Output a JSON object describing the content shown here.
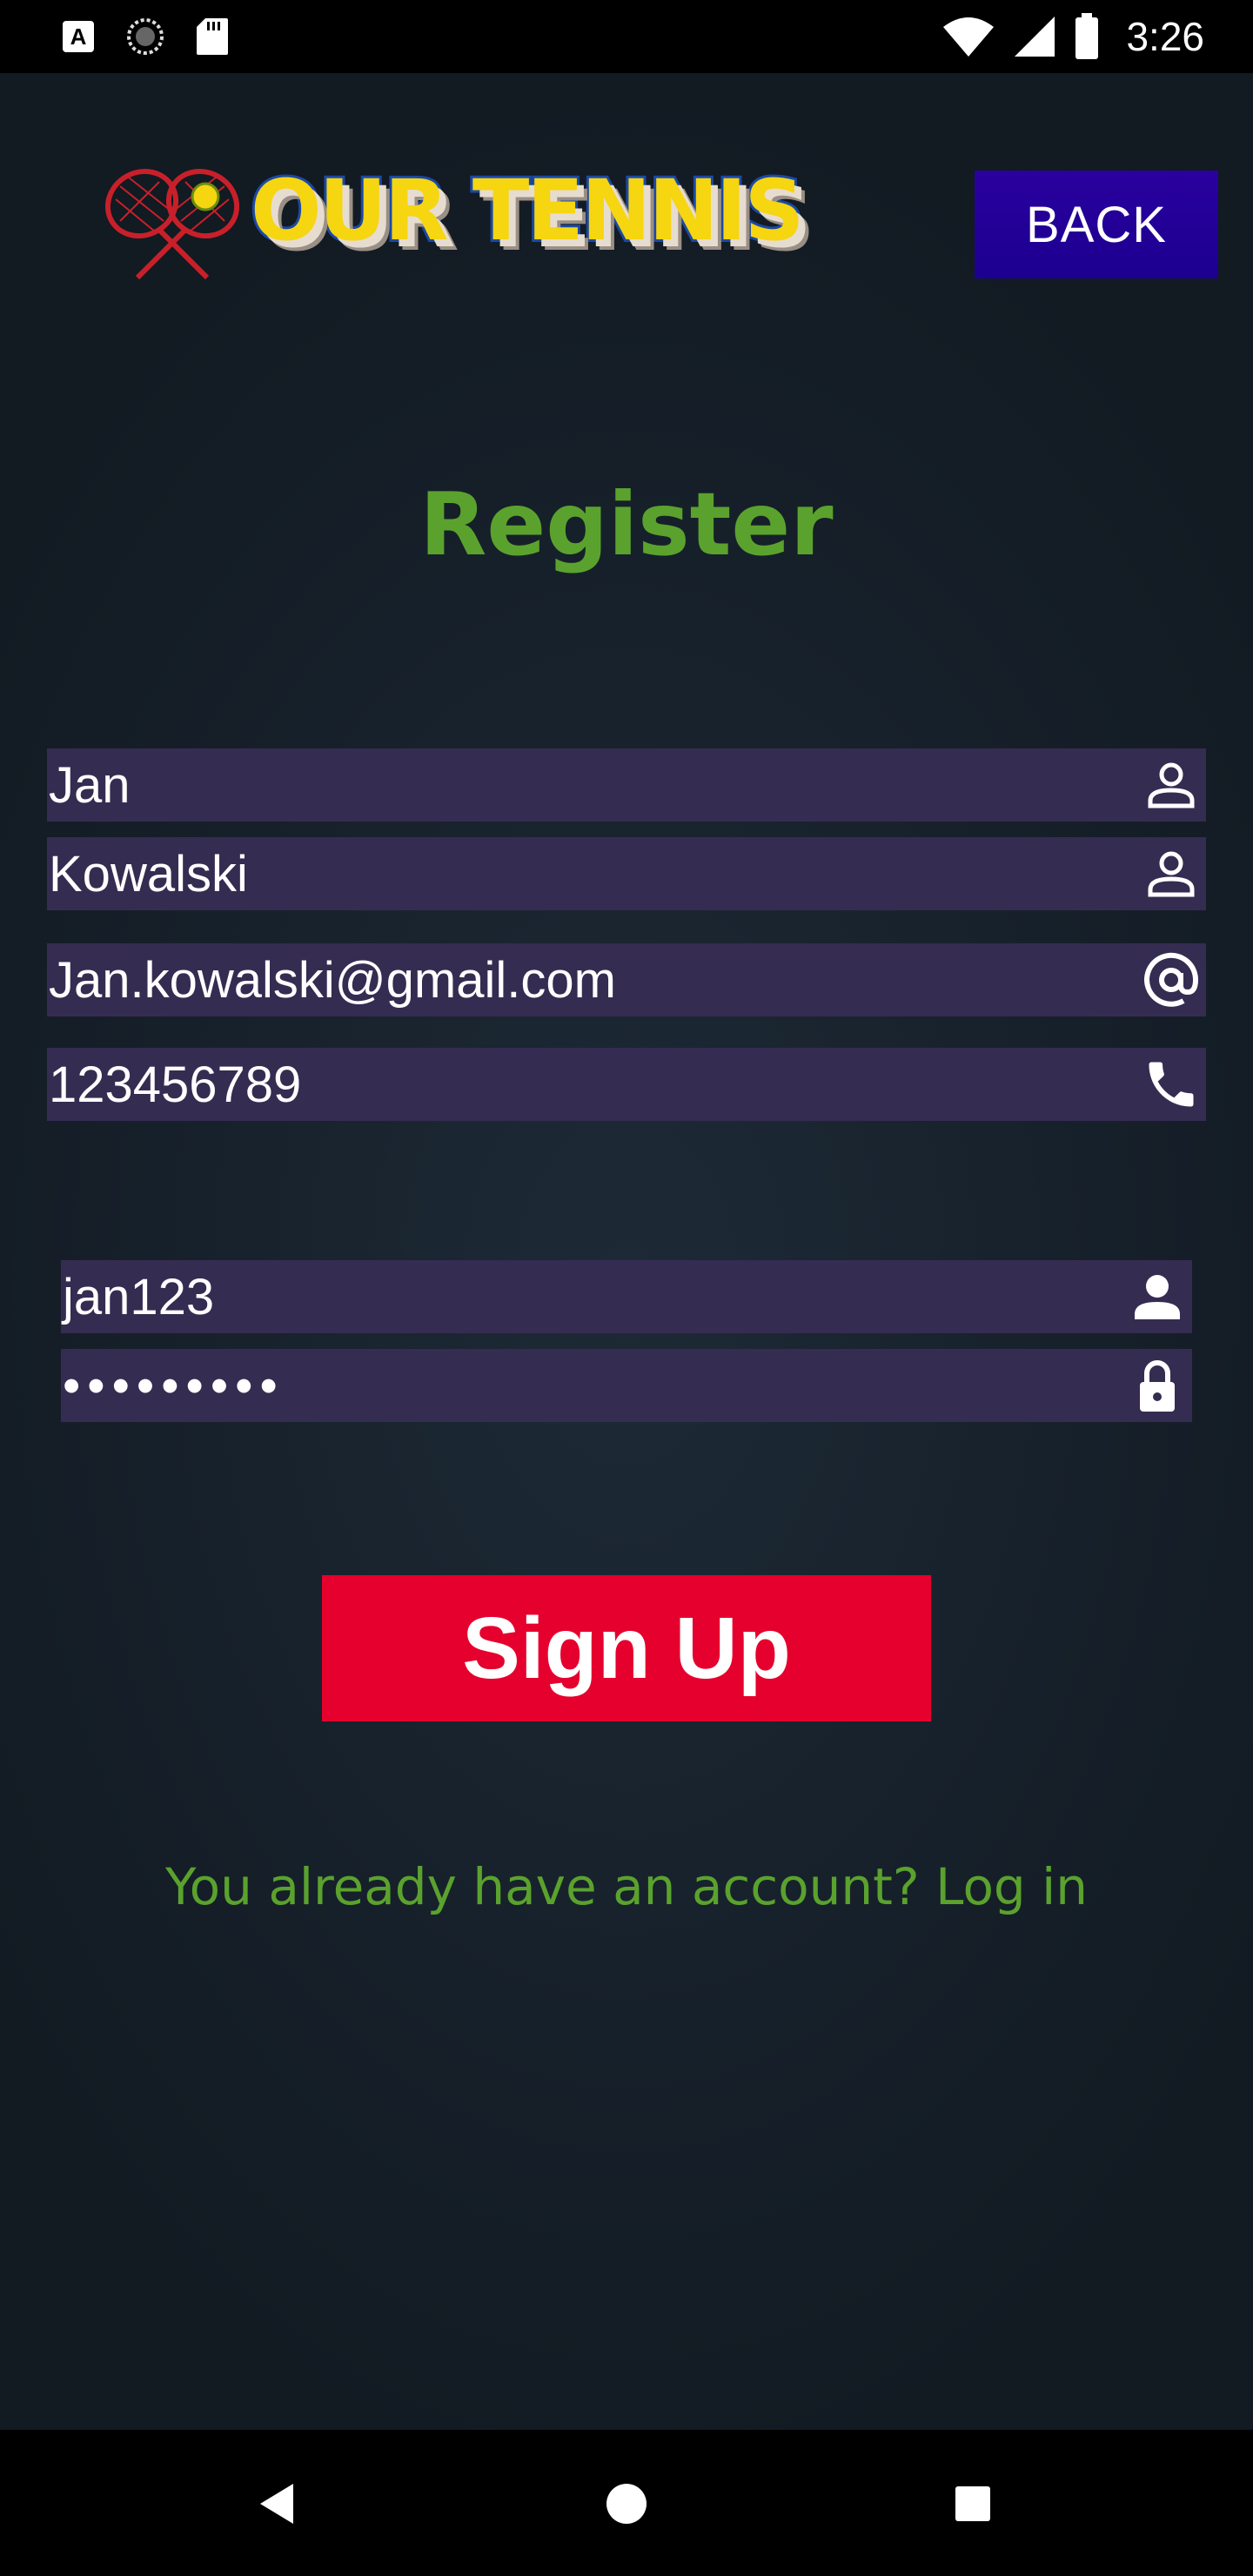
{
  "status_bar": {
    "time": "3:26",
    "icons": [
      "a-notification-icon",
      "sync-icon",
      "sd-card-icon",
      "wifi-icon",
      "signal-icon",
      "battery-icon"
    ]
  },
  "header": {
    "logo_text": "OUR TENNIS",
    "back_label": "BACK"
  },
  "page": {
    "title": "Register"
  },
  "form": {
    "first_name": "Jan",
    "last_name": "Kowalski",
    "email": "Jan.kowalski@gmail.com",
    "phone": "123456789",
    "username": "jan123",
    "password_masked": "•••••••••"
  },
  "actions": {
    "signup_label": "Sign Up",
    "login_link": "You already have an account? Log in"
  },
  "colors": {
    "accent_green": "#5aa22d",
    "field_bg": "#352c52",
    "signup_red": "#e5002e",
    "back_blue": "#2100a0"
  }
}
